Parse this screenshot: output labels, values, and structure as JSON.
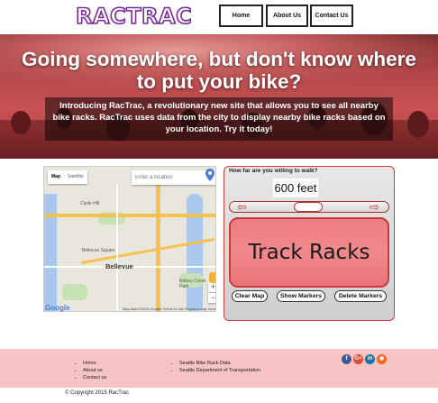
{
  "header": {
    "logo": "RACTRAC",
    "nav": [
      {
        "label": "Home"
      },
      {
        "label": "About Us"
      },
      {
        "label": "Contact Us"
      }
    ]
  },
  "hero": {
    "title": "Going somewhere, but don't know where to put your bike?",
    "body": "Introducing RacTrac, a revolutionary new site that allows you to see all nearby bike racks. RacTrac uses data from the city to display nearby bike racks based on your location. Try it today!"
  },
  "map": {
    "map_type": [
      "Map",
      "Satellite"
    ],
    "search_placeholder": "Enter a location",
    "city_label": "Bellevue",
    "place_labels": [
      "Clyde Hill",
      "Bellevue Square",
      "Kelsey Creek Park"
    ],
    "zoom_in": "+",
    "zoom_out": "−",
    "google_logo": "Google",
    "footer_text": "Map data ©2016 Google   Terms of Use   Report a map error"
  },
  "panel": {
    "question": "How far are you willing to walk?",
    "distance": "600 feet",
    "track_label": "Track Racks",
    "buttons": [
      "Clear Map",
      "Show Markers",
      "Delete Markers"
    ]
  },
  "footer": {
    "col1": [
      "Home",
      "About us",
      "Contact us"
    ],
    "col2": [
      "Seattle Bike Rack Data",
      "Seattle Department of Transportation"
    ],
    "social": [
      {
        "name": "facebook-icon",
        "glyph": "f",
        "color": "#3b5998"
      },
      {
        "name": "google-plus-icon",
        "glyph": "G+",
        "color": "#dd4b39"
      },
      {
        "name": "linkedin-icon",
        "glyph": "in",
        "color": "#0e76a8"
      },
      {
        "name": "rss-icon",
        "glyph": "◉",
        "color": "#f26522"
      }
    ],
    "copyright": "© Copyright 2015 RacTrac"
  }
}
